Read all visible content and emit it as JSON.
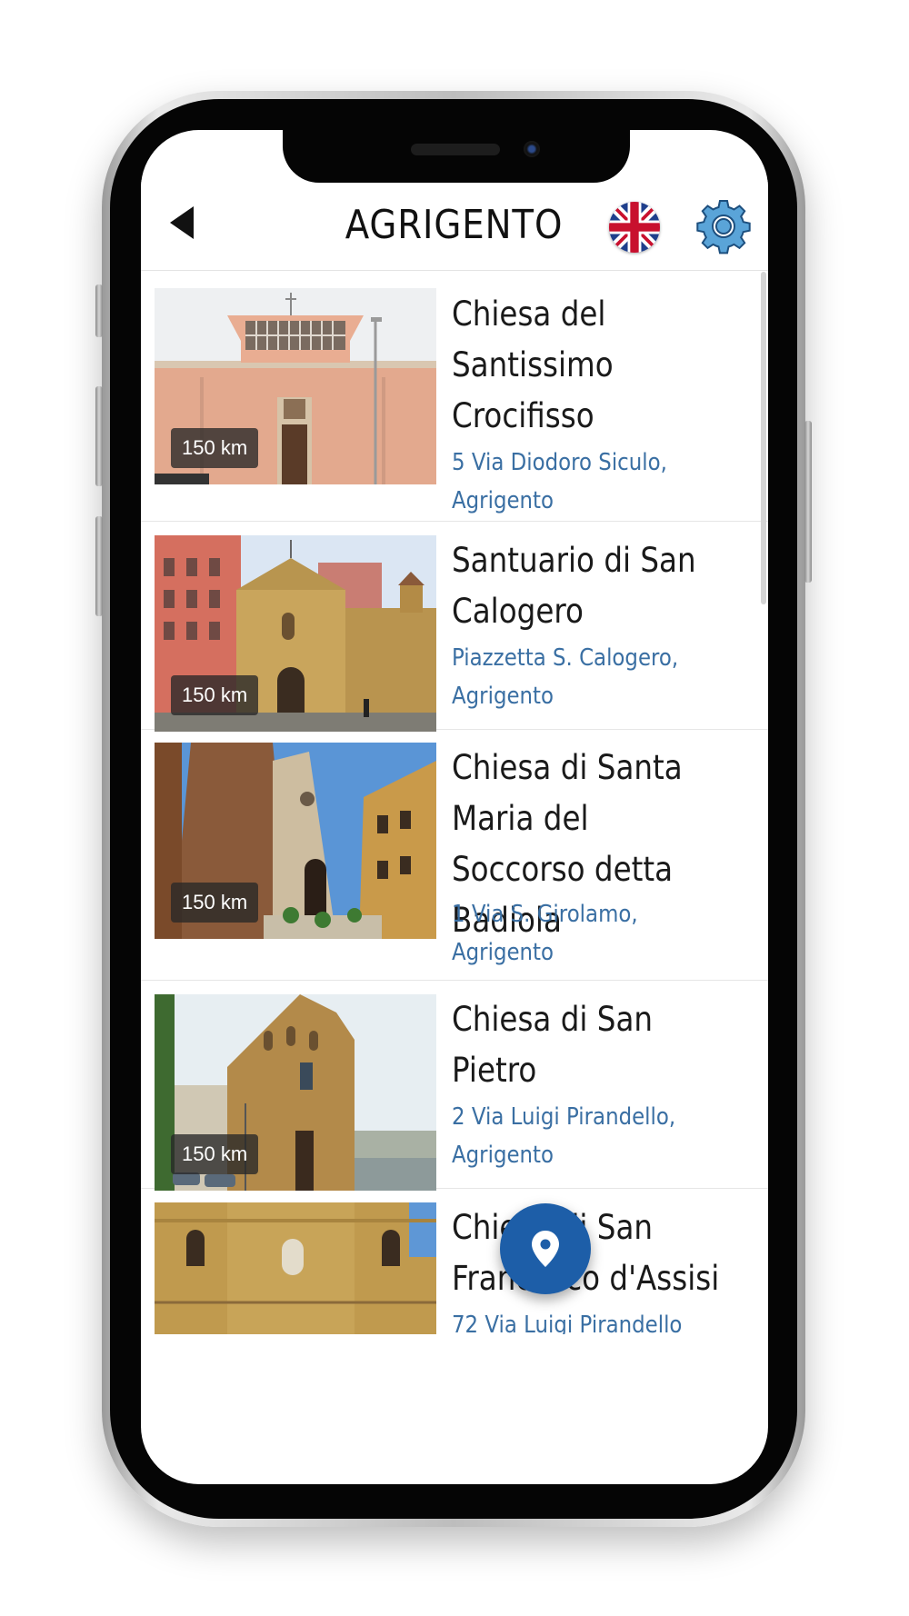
{
  "header": {
    "title": "AGRIGENTO",
    "back_icon": "back-arrow-icon",
    "language_icon": "uk-flag-icon",
    "settings_icon": "gear-icon"
  },
  "colors": {
    "accent": "#1d5ea8",
    "address_text": "#3a6fa3",
    "title_text": "#1a1a1a"
  },
  "places": [
    {
      "title": "Chiesa del Santissimo Crocifisso",
      "address": "5 Via Diodoro Siculo, Agrigento",
      "distance": "150 km"
    },
    {
      "title": "Santuario di San Calogero",
      "address": "Piazzetta S. Calogero, Agrigento",
      "distance": "150 km"
    },
    {
      "title": "Chiesa di Santa Maria del Soccorso detta Badiola",
      "address": "1 Via S. Girolamo, Agrigento",
      "distance": "150 km"
    },
    {
      "title": "Chiesa di San Pietro",
      "address": "2 Via Luigi Pirandello, Agrigento",
      "distance": "150 km"
    },
    {
      "title": "Chiesa di San Francesco d'Assisi",
      "address": "72 Via Luigi Pirandello",
      "distance": ""
    }
  ],
  "map_button": {
    "icon": "map-pin-icon"
  }
}
